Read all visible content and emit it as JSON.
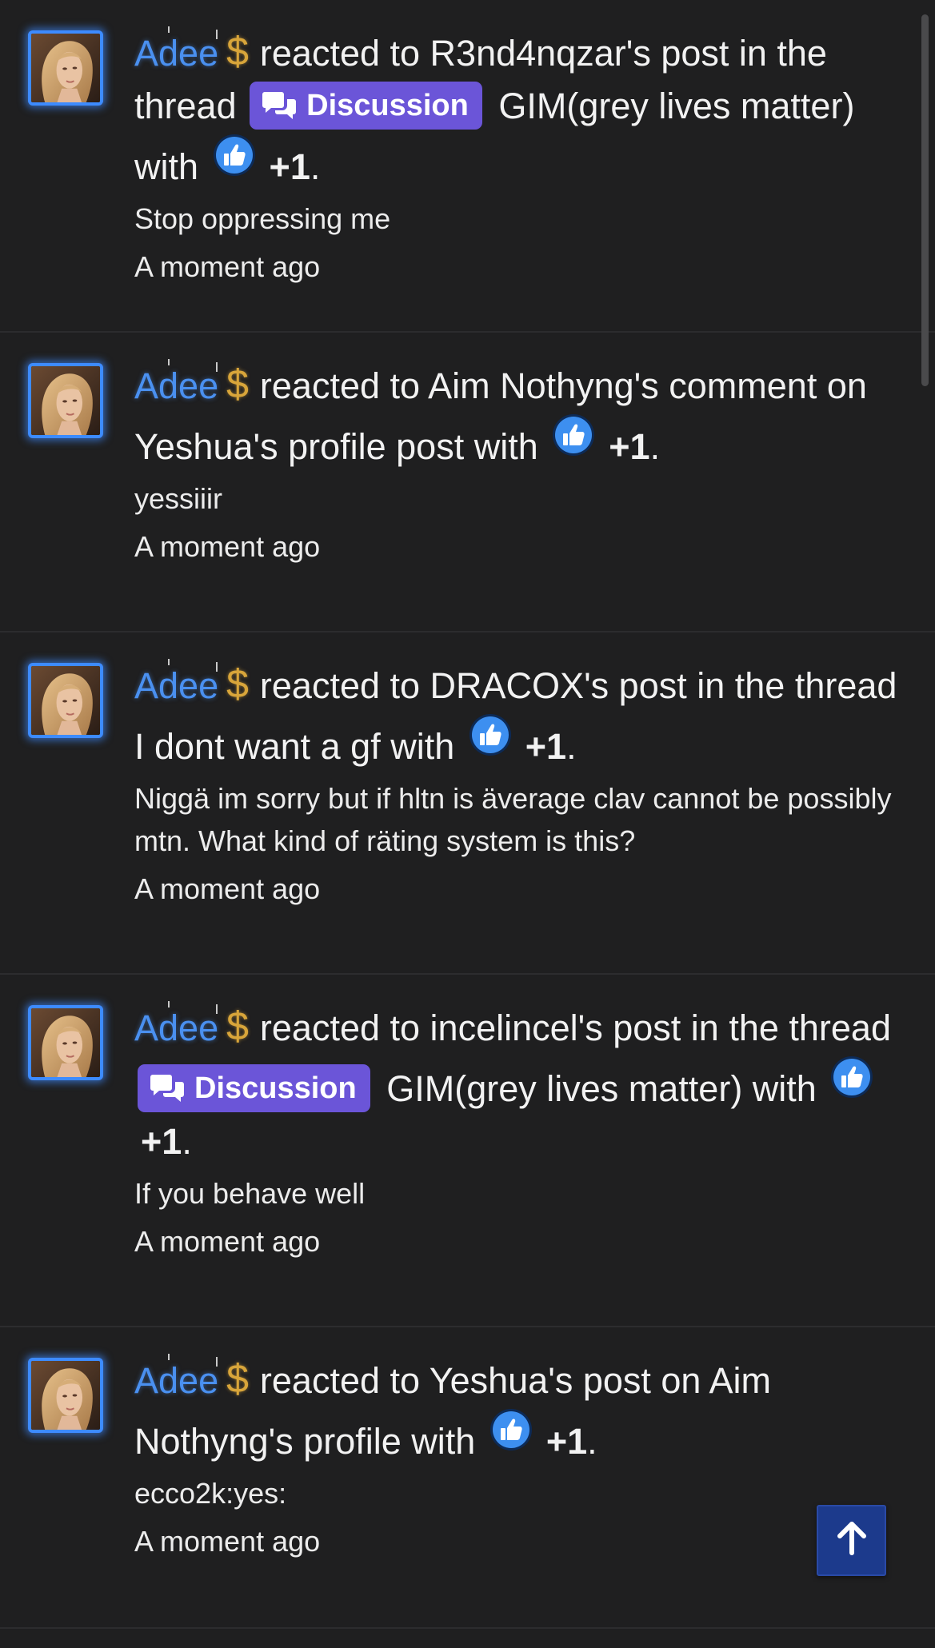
{
  "colors": {
    "background": "#1f1f20",
    "username": "#4a90f0",
    "badge": "#6b55d8",
    "dollar": "#d8a53a",
    "back_to_top": "#1c3a8c"
  },
  "icons": {
    "avatar": "portrait-photo",
    "dollar": "dollar-sign-icon",
    "badge": "chat-bubbles-icon",
    "reaction": "thumbs-up-icon",
    "back_to_top": "arrow-up-icon"
  },
  "alerts": [
    {
      "user": "Adee",
      "currency": "$",
      "text_before": "reacted to R3nd4nqzar's post in the thread",
      "badge": "Discussion",
      "text_after": "GIM(grey lives matter) with",
      "reaction": "+1",
      "end": ".",
      "snippet": "Stop oppressing me",
      "time": "A moment ago"
    },
    {
      "user": "Adee",
      "currency": "$",
      "text_before": "reacted to Aim Nothyng's comment on Yeshua's profile post with",
      "badge": null,
      "text_after": "",
      "reaction": "+1",
      "end": ".",
      "snippet": "yessiiir",
      "time": "A moment ago"
    },
    {
      "user": "Adee",
      "currency": "$",
      "text_before": "reacted to DRACOX's post in the thread I dont want a gf with",
      "badge": null,
      "text_after": "",
      "reaction": "+1",
      "end": ".",
      "snippet": "Niggä im sorry but if hltn is äverage clav cannot be possibly mtn. What kind of räting system is this?",
      "time": "A moment ago"
    },
    {
      "user": "Adee",
      "currency": "$",
      "text_before": "reacted to incelincel's post in the thread",
      "badge": "Discussion",
      "text_after": "GIM(grey lives matter) with",
      "reaction": "+1",
      "end": ".",
      "snippet": "If you behave well",
      "time": "A moment ago"
    },
    {
      "user": "Adee",
      "currency": "$",
      "text_before": "reacted to Yeshua's post on Aim Nothyng's profile with",
      "badge": null,
      "text_after": "",
      "reaction": "+1",
      "end": ".",
      "snippet": "ecco2k:yes:",
      "time": "A moment ago"
    }
  ]
}
